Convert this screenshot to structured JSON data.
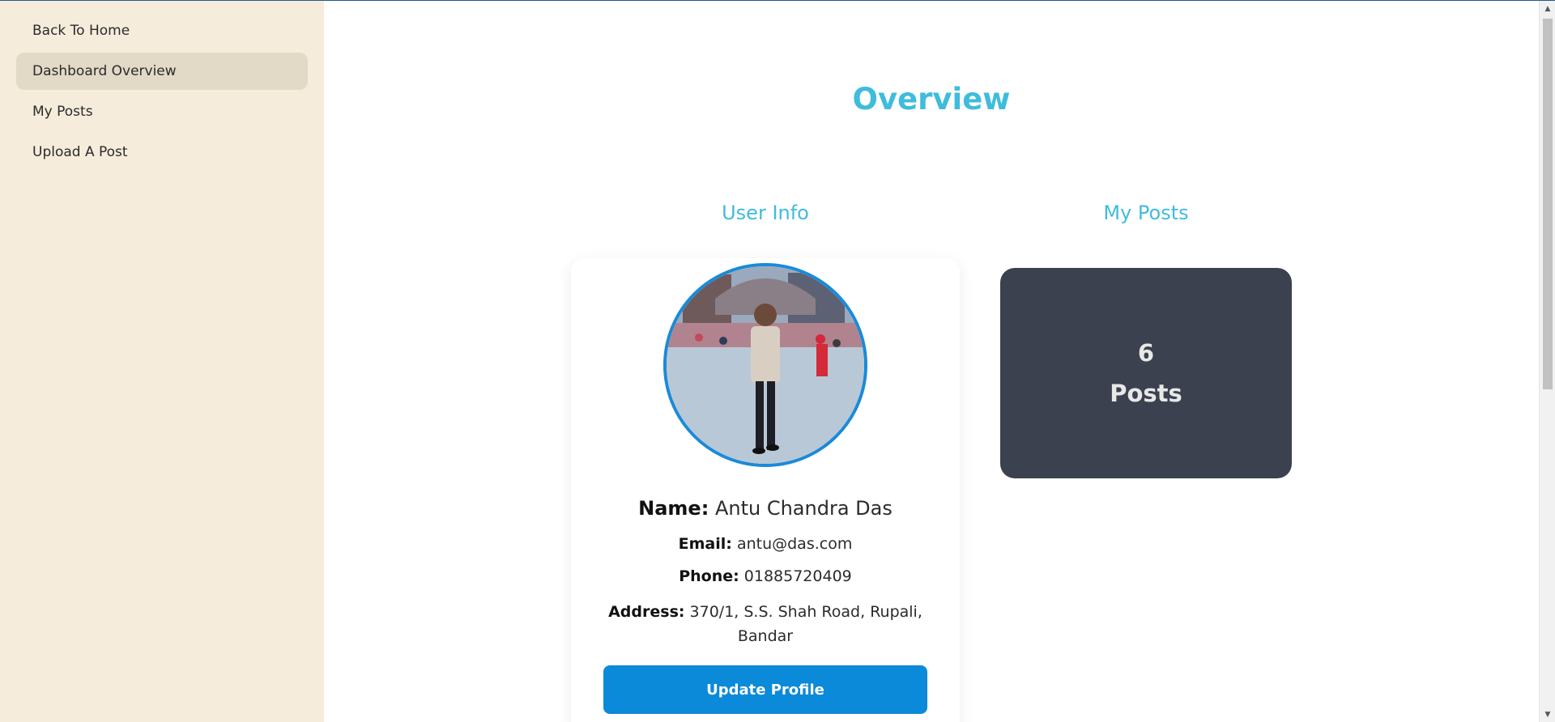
{
  "sidebar": {
    "items": [
      {
        "label": "Back To Home"
      },
      {
        "label": "Dashboard Overview"
      },
      {
        "label": "My Posts"
      },
      {
        "label": "Upload A Post"
      }
    ]
  },
  "main": {
    "title": "Overview",
    "user_info": {
      "title": "User Info",
      "name_label": "Name:",
      "name": "Antu Chandra Das",
      "email_label": "Email:",
      "email": "antu@das.com",
      "phone_label": "Phone:",
      "phone": "01885720409",
      "address_label": "Address:",
      "address": "370/1, S.S. Shah Road, Rupali, Bandar",
      "update_button": "Update Profile"
    },
    "my_posts": {
      "title": "My Posts",
      "count": "6",
      "label": "Posts"
    }
  },
  "colors": {
    "accent": "#3fbcdc",
    "button": "#0a8ad8",
    "sidebar_bg": "#f6ecdc",
    "sidebar_active": "#e2d9c7",
    "posts_card": "#3b414f"
  }
}
